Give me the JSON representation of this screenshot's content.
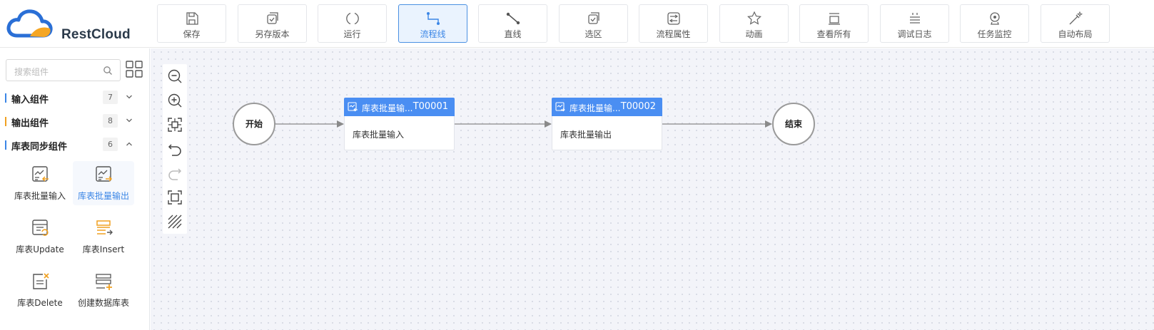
{
  "app": {
    "name": "RestCloud"
  },
  "toolbar": [
    {
      "label": "保存",
      "icon": "save-icon"
    },
    {
      "label": "另存版本",
      "icon": "save-version-icon"
    },
    {
      "label": "运行",
      "icon": "run-icon"
    },
    {
      "label": "流程线",
      "icon": "flow-line-icon",
      "active": true
    },
    {
      "label": "直线",
      "icon": "straight-line-icon"
    },
    {
      "label": "选区",
      "icon": "selection-icon"
    },
    {
      "label": "流程属性",
      "icon": "flow-properties-icon"
    },
    {
      "label": "动画",
      "icon": "animation-icon"
    },
    {
      "label": "查看所有",
      "icon": "view-all-icon"
    },
    {
      "label": "调试日志",
      "icon": "debug-log-icon"
    },
    {
      "label": "任务监控",
      "icon": "task-monitor-icon"
    },
    {
      "label": "自动布局",
      "icon": "auto-layout-icon"
    }
  ],
  "sidebar": {
    "search_placeholder": "搜索组件",
    "groups": [
      {
        "name": "输入组件",
        "count": "7",
        "expanded": false,
        "color": "#3b86e6"
      },
      {
        "name": "输出组件",
        "count": "8",
        "expanded": false,
        "color": "#f0a020"
      },
      {
        "name": "库表同步组件",
        "count": "6",
        "expanded": true,
        "color": "#3b86e6"
      }
    ],
    "components": [
      {
        "label": "库表批量输入",
        "icon": "table-batch-input-icon"
      },
      {
        "label": "库表批量输出",
        "icon": "table-batch-output-icon",
        "selected": true
      },
      {
        "label": "库表Update",
        "icon": "table-update-icon"
      },
      {
        "label": "库表Insert",
        "icon": "table-insert-icon"
      },
      {
        "label": "库表Delete",
        "icon": "table-delete-icon"
      },
      {
        "label": "创建数据库表",
        "icon": "create-table-icon"
      }
    ]
  },
  "canvas_tools": [
    "zoom-out-icon",
    "zoom-in-icon",
    "fit-view-icon",
    "undo-icon",
    "redo-icon",
    "actual-size-icon",
    "grid-toggle-icon"
  ],
  "flow": {
    "start": "开始",
    "end": "结束",
    "tasks": [
      {
        "title": "库表批量输...",
        "id": "T00001",
        "body": "库表批量输入"
      },
      {
        "title": "库表批量输...",
        "id": "T00002",
        "body": "库表批量输出"
      }
    ]
  },
  "colors": {
    "accent": "#3b86e6",
    "task_header": "#4a8ef2",
    "orange": "#f0a020"
  }
}
